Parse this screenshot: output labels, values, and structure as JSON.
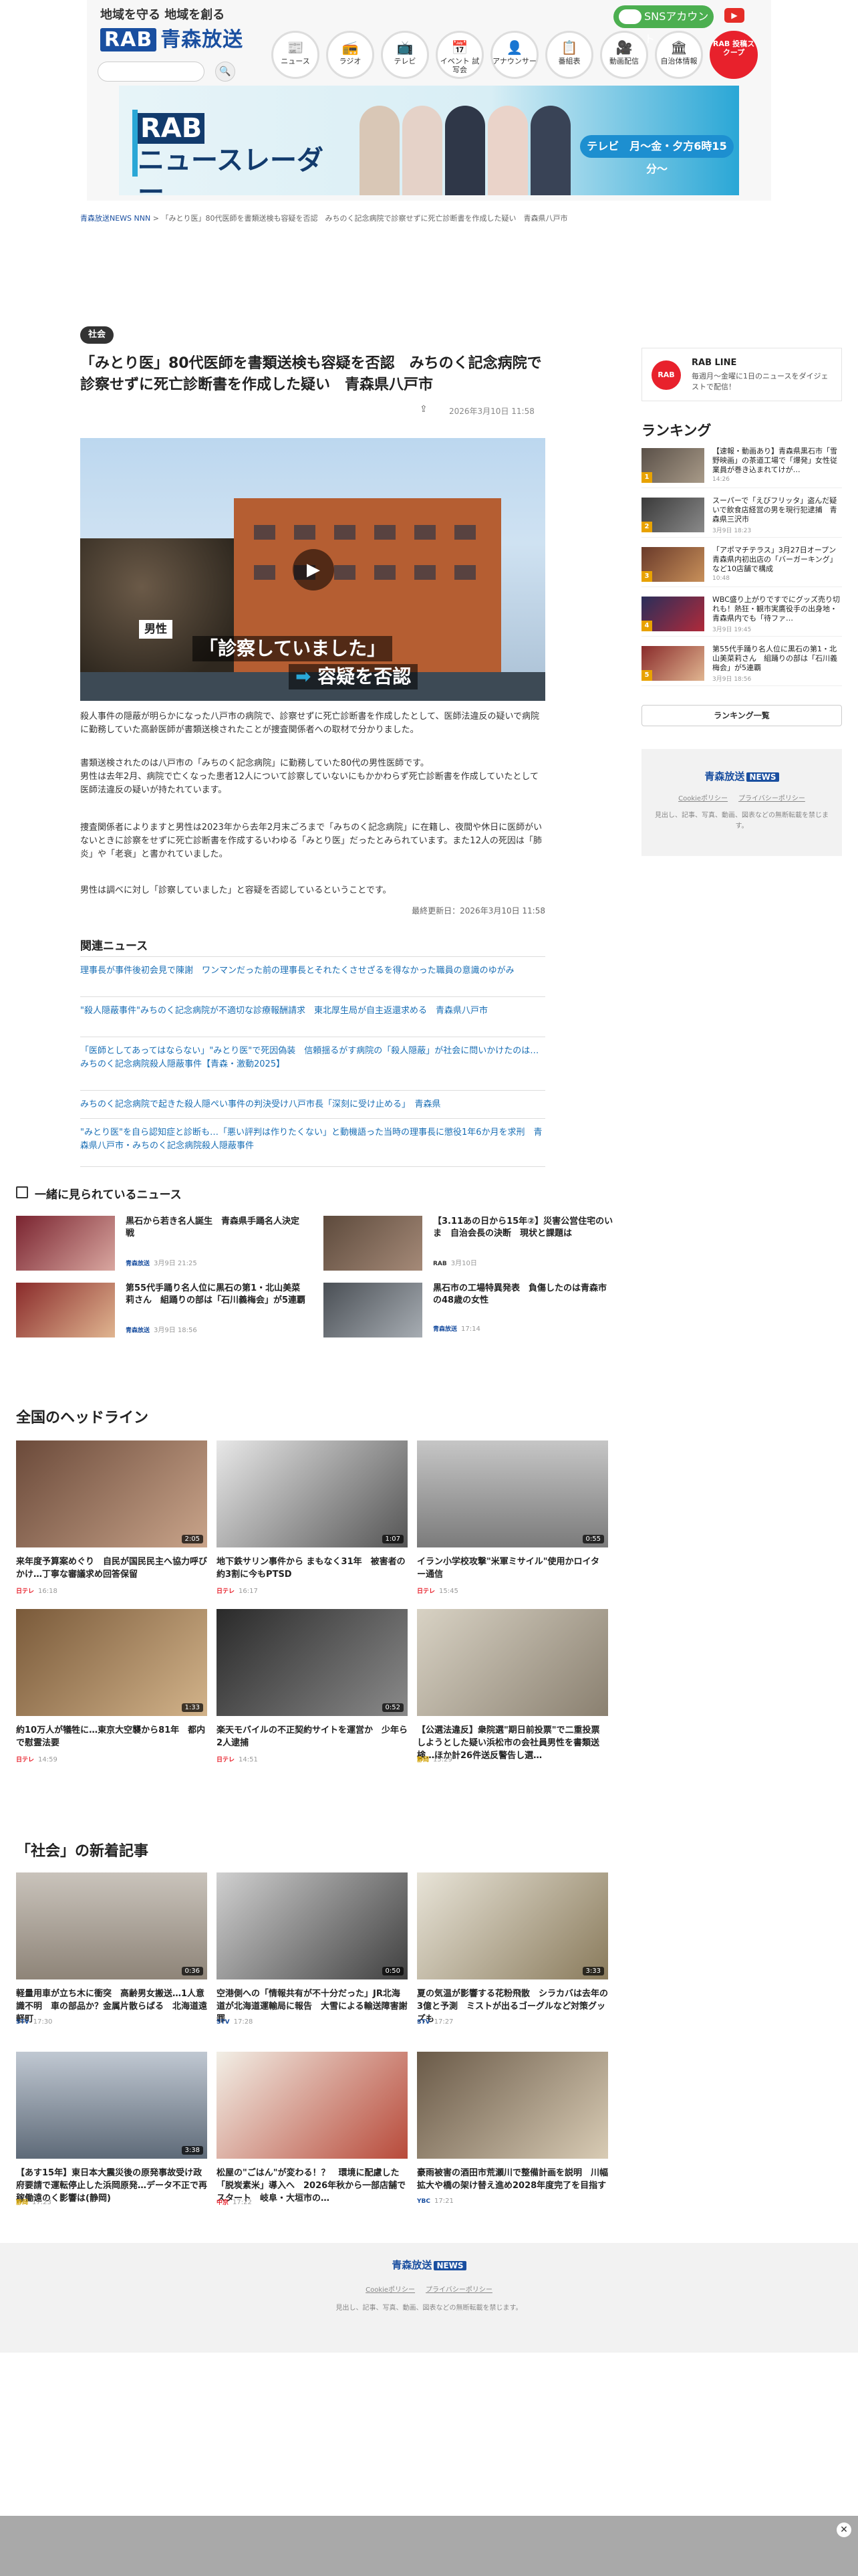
{
  "header": {
    "tagline": "地域を守る 地域を創る",
    "brand_rab": "RAB",
    "brand_name": "青森放送",
    "sns_label": "SNSアカウント",
    "nav": [
      {
        "icon": "📰",
        "label": "ニュース"
      },
      {
        "icon": "📻",
        "label": "ラジオ"
      },
      {
        "icon": "📺",
        "label": "テレビ"
      },
      {
        "icon": "📅",
        "label": "イベント 試写会"
      },
      {
        "icon": "👤",
        "label": "アナウンサー"
      },
      {
        "icon": "📋",
        "label": "番組表"
      },
      {
        "icon": "🎥",
        "label": "動画配信"
      },
      {
        "icon": "🏛",
        "label": "自治体情報"
      },
      {
        "icon": "",
        "label": "RAB 投稿スクープ"
      }
    ],
    "banner": {
      "rab": "RAB",
      "title": "ニュースレーダー",
      "time": "テレビ　月〜金・夕方6時15分〜"
    }
  },
  "breadcrumb": [
    "青森放送NEWS NNN",
    "「みとり医」80代医師を書類送検も容疑を否認　みちのく記念病院で診察せずに死亡診断書を作成した疑い　青森県八戸市"
  ],
  "article": {
    "category": "社会",
    "title": "「みとり医」80代医師を書類送検も容疑を否認　みちのく記念病院で診察せずに死亡診断書を作成した疑い　青森県八戸市",
    "date": "2026年3月10日 11:58",
    "video": {
      "tag": "男性",
      "caption1": "「診察していました」",
      "caption2_arrow": "➡",
      "caption2": "容疑を否認"
    },
    "paragraphs": [
      "殺人事件の隠蔽が明らかになった八戸市の病院で、診察せずに死亡診断書を作成したとして、医師法違反の疑いで病院に勤務していた高齢医師が書類送検されたことが捜査関係者への取材で分かりました。",
      "書類送検されたのは八戸市の「みちのく記念病院」に勤務していた80代の男性医師です。\n男性は去年2月、病院で亡くなった患者12人について診察していないにもかかわらず死亡診断書を作成していたとして医師法違反の疑いが持たれています。",
      "捜査関係者によりますと男性は2023年から去年2月末ごろまで「みちのく記念病院」に在籍し、夜間や休日に医師がいないときに診察をせずに死亡診断書を作成するいわゆる「みとり医」だったとみられています。また12人の死因は「肺炎」や「老衰」と書かれていました。",
      "男性は調べに対し「診察していました」と容疑を否認しているということです。"
    ],
    "updated": "最終更新日：2026年3月10日 11:58"
  },
  "related": {
    "heading": "関連ニュース",
    "items": [
      "理事長が事件後初会見で陳謝　ワンマンだった前の理事長とそれたくさせざるを得なかった職員の意識のゆがみ",
      "\"殺人隠蔽事件\"みちのく記念病院が不適切な診療報酬請求　東北厚生局が自主返還求める　青森県八戸市",
      "「医師としてあってはならない」\"みとり医\"で死因偽装　信頼揺るがす病院の「殺人隠蔽」が社会に問いかけたのは…　みちのく記念病院殺人隠蔽事件【青森・激動2025】",
      "みちのく記念病院で起きた殺人隠ぺい事件の判決受け八戸市長「深刻に受け止める」　青森県",
      "\"みとり医\"を自ら認知症と診断も…「悪い評判は作りたくない」と動機語った当時の理事長に懲役1年6か月を求刑　青森県八戸市・みちのく記念病院殺人隠蔽事件"
    ]
  },
  "popular": {
    "heading": "一緒に見られているニュース",
    "items": [
      {
        "title": "黒石から若き名人誕生　青森県手踊名人決定戦",
        "source": "青森放送",
        "date": "3月9日 21:25"
      },
      {
        "title": "【3.11あの日から15年②】災害公営住宅のいま　自治会長の決断　現状と課題は",
        "source": "RAB",
        "date": "3月10日"
      },
      {
        "title": "第55代手踊り名人位に黒石の第1・北山美菜莉さん　組踊りの部は「石川義梅会」が5連覇",
        "source": "青森放送",
        "date": "3月9日 18:56"
      },
      {
        "title": "黒石市の工場特異発表　負傷したのは青森市の48歳の女性",
        "source": "青森放送",
        "date": "17:14"
      }
    ]
  },
  "headlines": {
    "heading": "全国のヘッドライン",
    "items": [
      {
        "title": "来年度予算案めぐり　自民が国民民主へ協力呼びかけ…丁寧な審議求め回答保留",
        "source": "日テレ",
        "time": "16:18",
        "dur": "2:05"
      },
      {
        "title": "地下鉄サリン事件から まもなく31年　被害者の約3割に今もPTSD",
        "source": "日テレ",
        "time": "16:17",
        "dur": "1:07"
      },
      {
        "title": "イラン小学校攻撃\"米軍ミサイル\"使用かロイター通信",
        "source": "日テレ",
        "time": "15:45",
        "dur": "0:55"
      },
      {
        "title": "約10万人が犠牲に…東京大空襲から81年　都内で慰霊法要",
        "source": "日テレ",
        "time": "14:59",
        "dur": "1:33"
      },
      {
        "title": "楽天モバイルの不正契約サイトを運営か　少年ら2人逮捕",
        "source": "日テレ",
        "time": "14:51",
        "dur": "0:52"
      },
      {
        "title": "【公選法違反】衆院選\"期日前投票\"で二重投票しようとした疑い浜松市の会社員男性を書類送検…ほか計26件送反警告し選…",
        "source": "静岡",
        "time": "15:29",
        "dur": ""
      }
    ]
  },
  "social": {
    "heading": "「社会」の新着記事",
    "items": [
      {
        "title": "軽量用車が立ち木に衝突　高齢男女搬送…1人意識不明　車の部品か？金属片散らばる　北海道遠軽町",
        "source": "STV",
        "time": "17:30",
        "dur": "0:36"
      },
      {
        "title": "空港側への「情報共有が不十分だった」JR北海道が北海道運輸局に報告　大雪による輸送障害謝罪",
        "source": "STV",
        "time": "17:28",
        "dur": "0:50"
      },
      {
        "title": "夏の気温が影響する花粉飛散　シラカバは去年の3億と予測　ミストが出るゴーグルなど対策グッズも",
        "source": "STV",
        "time": "17:27",
        "dur": "3:33"
      },
      {
        "title": "【あす15年】東日本大震災後の原発事故受け政府要請で運転停止した浜岡原発…データ不正で再稼働遠のく影響は(静岡)",
        "source": "静岡",
        "time": "17:23",
        "dur": "3:38"
      },
      {
        "title": "松屋の\"ごはん\"が変わる！？　環境に配慮した「脱炭素米」導入へ　2026年秋から一部店舗でスタート　岐阜・大垣市の…",
        "source": "中京",
        "time": "17:22",
        "dur": ""
      },
      {
        "title": "豪雨被害の酒田市荒瀬川で整備計画を説明　川幅拡大や橋の架け替え進め2028年度完了を目指す",
        "source": "YBC",
        "time": "17:21",
        "dur": ""
      }
    ]
  },
  "sidebar": {
    "rabline_title": "RAB LINE",
    "rabline_desc": "毎週月〜金曜に1日のニュースをダイジェストで配信！",
    "rabline_logo": "RAB",
    "ranking_heading": "ランキング",
    "ranking": [
      {
        "no": "1",
        "title": "【速報・動画あり】青森県黒石市「雪野映画」の茶道工場で「爆発」女性従業員が巻き込まれてけが…",
        "date": "14:26"
      },
      {
        "no": "2",
        "title": "スーパーで「えびフリッタ」盗んだ疑いで飲食店経営の男を現行犯逮捕　青森県三沢市",
        "date": "3月9日 18:23"
      },
      {
        "no": "3",
        "title": "「アポマチテラス」3月27日オープン　青森県内初出店の「バーガーキング」など10店舗で構成",
        "date": "10:48"
      },
      {
        "no": "4",
        "title": "WBC盛り上がりですでにグッズ売り切れも！熱狂・観市実鷹役手の出身地・青森県内でも「待ファ…",
        "date": "3月9日 19:45"
      },
      {
        "no": "5",
        "title": "第55代手踊り名人位に黒石の第1・北山美菜莉さん　組踊りの部は「石川義梅会」が5連覇",
        "date": "3月9日 18:56"
      }
    ],
    "ranking_more": "ランキング一覧"
  },
  "footer": {
    "logo_text": "青森放送",
    "logo_badge": "NEWS",
    "links": [
      "Cookieポリシー",
      "プライバシーポリシー"
    ],
    "note": "見出し、記事、写真、動画、図表などの無断転載を禁じます。"
  },
  "colors": {
    "brand": "#1a4fa0",
    "accent_red": "#e8212c",
    "link": "#1a6fb5"
  }
}
